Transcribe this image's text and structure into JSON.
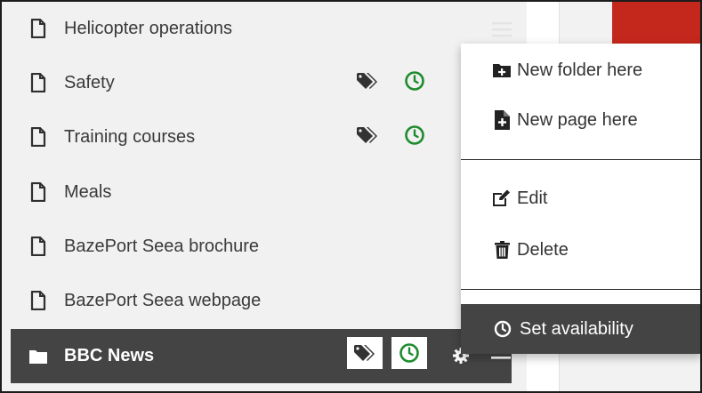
{
  "tree": {
    "items": [
      {
        "label": "Helicopter operations",
        "icon": "file-icon"
      },
      {
        "label": "Safety",
        "icon": "file-icon",
        "has_tag": true,
        "has_schedule": true
      },
      {
        "label": "Training courses",
        "icon": "file-icon",
        "has_tag": true,
        "has_schedule": true
      },
      {
        "label": "Meals",
        "icon": "file-icon"
      },
      {
        "label": "BazePort Seea brochure",
        "icon": "file-icon"
      },
      {
        "label": "BazePort Seea webpage",
        "icon": "file-icon"
      },
      {
        "label": "BBC News",
        "icon": "folder-icon",
        "selected": true,
        "has_tag": true,
        "has_schedule": true
      }
    ]
  },
  "context_menu": {
    "new_folder": "New folder here",
    "new_page": "New page here",
    "edit": "Edit",
    "delete": "Delete",
    "set_availability": "Set availability"
  },
  "colors": {
    "selected_bg": "#444444",
    "schedule_green": "#1e8c2e",
    "accent_red": "#c4271c"
  }
}
